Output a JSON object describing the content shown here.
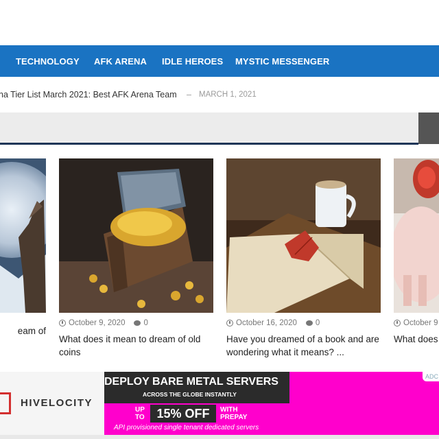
{
  "nav": {
    "items": [
      "TECHNOLOGY",
      "AFK ARENA",
      "IDLE HEROES",
      "MYSTIC MESSENGER"
    ]
  },
  "ticker": {
    "title": "na Tier List March 2021: Best AFK Arena Team",
    "separator": "–",
    "date": "MARCH 1, 2021"
  },
  "search": {
    "placeholder": ""
  },
  "cards": [
    {
      "date": "",
      "comments": "",
      "title": "eam of",
      "image": "wolf-moon"
    },
    {
      "date": "October 9, 2020",
      "comments": "0",
      "title": "What does it mean to dream of old coins",
      "image": "treasure-chest"
    },
    {
      "date": "October 16, 2020",
      "comments": "0",
      "title": "Have you dreamed of a book and are wondering what it means? ...",
      "image": "open-book"
    },
    {
      "date": "October 9",
      "comments": "",
      "title": "What does pig",
      "image": "pig"
    }
  ],
  "ad": {
    "brand": "HIVELOCITY",
    "headline": "DEPLOY BARE METAL SERVERS",
    "subheadline": "ACROSS THE GLOBE INSTANTLY",
    "up": "UP",
    "to": "TO",
    "offer": "15% OFF",
    "with": "WITH",
    "prepay": "PREPAY",
    "footnote": "API provisioned single tenant dedicated servers",
    "badge": "ADC",
    "bg_color": "#ff00cc"
  }
}
